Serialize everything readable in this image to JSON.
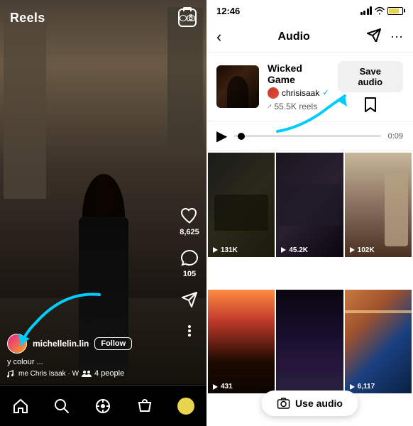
{
  "left": {
    "title": "Reels",
    "username": "michellelin.lin",
    "follow_label": "Follow",
    "caption": "y colour ...",
    "audio_info": "me Chris Isaak · W",
    "people_count": "4 people",
    "like_count": "8,625",
    "comment_count": "105",
    "camera_label": "camera"
  },
  "right": {
    "status_time": "12:46",
    "header_title": "Audio",
    "back_label": "back",
    "audio_title": "Wicked Game",
    "artist_name": "chrisisaak",
    "reels_count": "55.5K reels",
    "save_audio_label": "Save audio",
    "duration": "0:09",
    "use_audio_label": "Use audio",
    "videos": [
      {
        "count": "131K",
        "id": 1
      },
      {
        "count": "45.2K",
        "id": 2
      },
      {
        "count": "102K",
        "id": 3
      },
      {
        "count": "431",
        "id": 4
      },
      {
        "count": "",
        "id": 5
      },
      {
        "count": "6,117",
        "id": 6
      }
    ]
  }
}
